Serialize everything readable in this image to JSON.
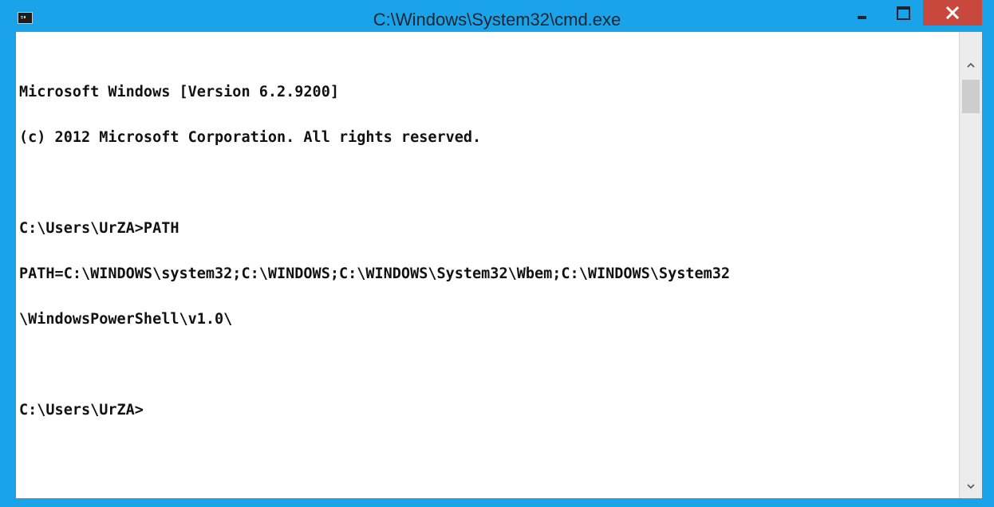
{
  "window": {
    "title": "C:\\Windows\\System32\\cmd.exe",
    "app_icon": "cmd-icon",
    "controls": {
      "minimize": "minimize-icon",
      "maximize": "maximize-icon",
      "close": "close-icon"
    }
  },
  "colors": {
    "frame": "#1aa3e8",
    "close_button": "#c9483e",
    "console_background": "#ffffff",
    "console_text": "#111111"
  },
  "console": {
    "lines": [
      "Microsoft Windows [Version 6.2.9200]",
      "(c) 2012 Microsoft Corporation. All rights reserved.",
      "",
      "C:\\Users\\UrZA>PATH",
      "PATH=C:\\WINDOWS\\system32;C:\\WINDOWS;C:\\WINDOWS\\System32\\Wbem;C:\\WINDOWS\\System32",
      "\\WindowsPowerShell\\v1.0\\",
      "",
      "C:\\Users\\UrZA>"
    ]
  },
  "scrollbar": {
    "up": "chevron-up-icon",
    "down": "chevron-down-icon"
  }
}
